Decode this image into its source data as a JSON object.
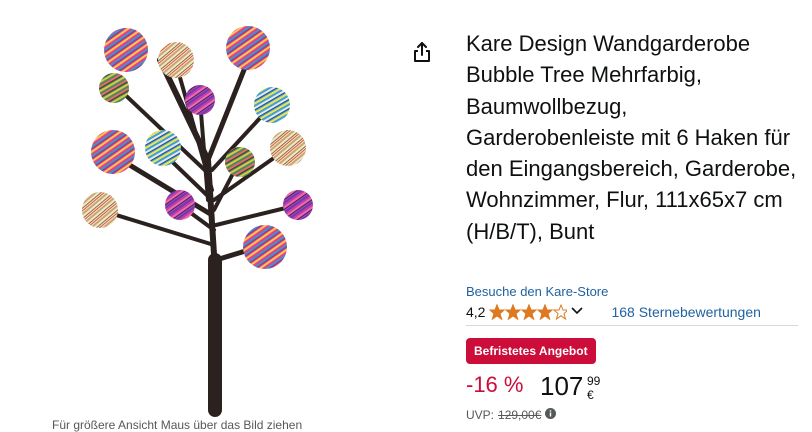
{
  "product": {
    "title": "Kare Design Wandgarderobe Bubble Tree Mehrfarbig, Baumwollbezug, Garderobenleiste mit 6 Haken für den Eingangsbereich, Garderobe, Wohnzimmer, Flur, 111x65x7 cm (H/B/T), Bunt",
    "store_link": "Besuche den Kare-Store",
    "rating_value": "4,2",
    "rating_fraction": 0.84,
    "review_count": "168 Sternebewertungen",
    "deal_badge": "Befristetes Angebot",
    "discount": "-16 %",
    "price_whole": "107",
    "price_fraction": "99 €",
    "uvp_label": "UVP:",
    "uvp_price": "129,00€",
    "image_hover_hint": "Für größere Ansicht Maus über das Bild ziehen"
  },
  "icons": {
    "share": "share-icon",
    "stars": "star-rating-icon",
    "chevron": "chevron-down-icon",
    "info": "info-icon"
  },
  "colors": {
    "star": "#DE7921",
    "link": "#2162A1",
    "deal": "#CC0C39",
    "text": "#0F1111",
    "muted": "#565959"
  }
}
